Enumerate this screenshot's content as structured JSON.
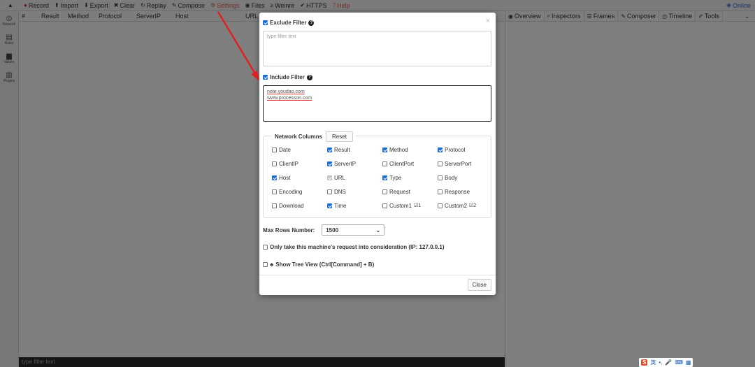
{
  "toolbar": {
    "items": [
      {
        "icon": "record-icon",
        "glyph": "●",
        "label": "Record"
      },
      {
        "icon": "import-icon",
        "glyph": "⬆",
        "label": "Import"
      },
      {
        "icon": "export-icon",
        "glyph": "⬇",
        "label": "Export"
      },
      {
        "icon": "clear-icon",
        "glyph": "✖",
        "label": "Clear"
      },
      {
        "icon": "replay-icon",
        "glyph": "↻",
        "label": "Replay"
      },
      {
        "icon": "compose-icon",
        "glyph": "✎",
        "label": "Compose"
      },
      {
        "icon": "settings-icon",
        "glyph": "⚙",
        "label": "Settings"
      },
      {
        "icon": "files-icon",
        "glyph": "◉",
        "label": "Files"
      },
      {
        "icon": "weinre-icon",
        "glyph": "≥",
        "label": "Weinre"
      },
      {
        "icon": "https-icon",
        "glyph": "✔",
        "label": "HTTPS"
      },
      {
        "icon": "help-icon",
        "glyph": "?",
        "label": "Help"
      }
    ],
    "online_label": "Online"
  },
  "sidebar": {
    "items": [
      {
        "icon": "network-icon",
        "glyph": "◎",
        "label": "Network"
      },
      {
        "icon": "rules-icon",
        "glyph": "▤",
        "label": "Rules"
      },
      {
        "icon": "values-icon",
        "glyph": "▆",
        "label": "Values"
      },
      {
        "icon": "plugins-icon",
        "glyph": "▥",
        "label": "Plugins"
      }
    ]
  },
  "network_header": {
    "columns": [
      "#",
      "Result",
      "Method",
      "Protocol",
      "ServerIP",
      "Host",
      "URL"
    ]
  },
  "network_footer": {
    "placeholder": "type filter text"
  },
  "right_tabs": {
    "items": [
      {
        "icon": "overview-icon",
        "glyph": "◉",
        "label": "Overview"
      },
      {
        "icon": "inspectors-icon",
        "glyph": "⌕",
        "label": "Inspectors"
      },
      {
        "icon": "frames-icon",
        "glyph": "☰",
        "label": "Frames"
      },
      {
        "icon": "composer-icon",
        "glyph": "✎",
        "label": "Composer"
      },
      {
        "icon": "timeline-icon",
        "glyph": "◷",
        "label": "Timeline"
      },
      {
        "icon": "tools-icon",
        "glyph": "✐",
        "label": "Tools"
      }
    ]
  },
  "modal": {
    "exclude_filter": {
      "label": "Exclude Filter",
      "checked": true,
      "placeholder": "type filter text"
    },
    "include_filter": {
      "label": "Include Filter",
      "checked": true,
      "lines": [
        "note.youdao.com",
        "www.processon.com"
      ]
    },
    "network_columns": {
      "title": "Network Columns",
      "reset_label": "Reset",
      "columns": [
        {
          "label": "Date",
          "state": "off"
        },
        {
          "label": "Result",
          "state": "on"
        },
        {
          "label": "Method",
          "state": "on"
        },
        {
          "label": "Protocol",
          "state": "on"
        },
        {
          "label": "ClientIP",
          "state": "off"
        },
        {
          "label": "ServerIP",
          "state": "on"
        },
        {
          "label": "ClientPort",
          "state": "off"
        },
        {
          "label": "ServerPort",
          "state": "off"
        },
        {
          "label": "Host",
          "state": "on"
        },
        {
          "label": "URL",
          "state": "disabled"
        },
        {
          "label": "Type",
          "state": "on"
        },
        {
          "label": "Body",
          "state": "off"
        },
        {
          "label": "Encoding",
          "state": "off"
        },
        {
          "label": "DNS",
          "state": "off"
        },
        {
          "label": "Request",
          "state": "off"
        },
        {
          "label": "Response",
          "state": "off"
        },
        {
          "label": "Download",
          "state": "off"
        },
        {
          "label": "Time",
          "state": "on"
        },
        {
          "label": "Custom1",
          "state": "off",
          "edit": "1"
        },
        {
          "label": "Custom2",
          "state": "off",
          "edit": "2"
        }
      ]
    },
    "max_rows": {
      "label": "Max Rows Number:",
      "value": "1500"
    },
    "only_machine": {
      "label": "Only take this machine's request into consideration (IP: 127.0.0.1)",
      "checked": false
    },
    "tree_view": {
      "label": "Show Tree View (Ctrl[Command] + B)",
      "checked": false
    },
    "close_label": "Close"
  },
  "ime": {
    "items": [
      "S",
      "英",
      "•,",
      "🎤",
      "⌨",
      "▦"
    ]
  },
  "colors": {
    "accent": "#1f6fd6",
    "settings_red": "#e06060",
    "arrow_red": "#e02020"
  }
}
